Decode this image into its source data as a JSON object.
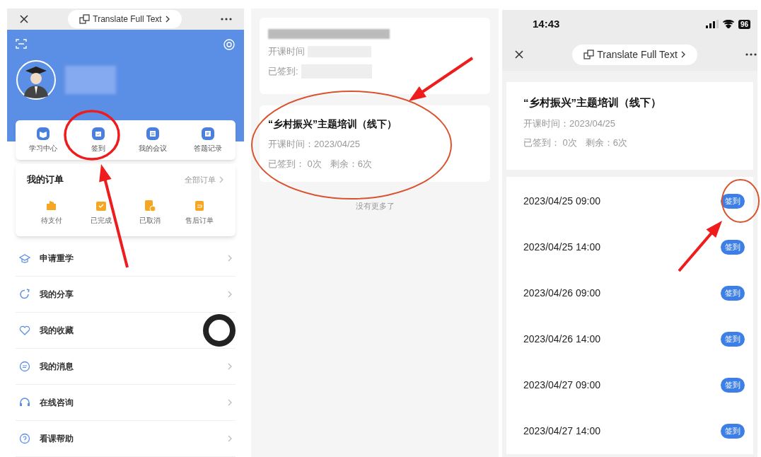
{
  "profile_screen": {
    "translate_label": "Translate Full Text",
    "quick_actions": [
      {
        "label": "学习中心"
      },
      {
        "label": "签到"
      },
      {
        "label": "我的会议"
      },
      {
        "label": "答题记录"
      }
    ],
    "orders": {
      "title": "我的订单",
      "all_link": "全部订单",
      "items": [
        {
          "label": "待支付"
        },
        {
          "label": "已完成"
        },
        {
          "label": "已取消"
        },
        {
          "label": "售后订单"
        }
      ]
    },
    "menu": [
      {
        "label": "申请重学",
        "floating_ball": false
      },
      {
        "label": "我的分享",
        "floating_ball": false
      },
      {
        "label": "我的收藏",
        "floating_ball": true
      },
      {
        "label": "我的消息",
        "floating_ball": false
      },
      {
        "label": "在线咨询",
        "floating_ball": false
      },
      {
        "label": "看课帮助",
        "floating_ball": false
      }
    ]
  },
  "course_list_screen": {
    "courses": [
      {
        "kind": "redacted",
        "start_label": "开课时间",
        "checkin_label": "已签到:"
      },
      {
        "kind": "full",
        "title": "“乡村振兴”主题培训（线下）",
        "start": "开课时间：2023/04/25",
        "checked": "已签到： 0次",
        "remaining": "剩余：6次"
      }
    ],
    "footer": "没有更多了"
  },
  "checkin_screen": {
    "time": "14:43",
    "battery": "96",
    "translate_label": "Translate Full Text",
    "course": {
      "title": "“乡村振兴”主题培训（线下）",
      "start": "开课时间：2023/04/25",
      "checked": "已签到： 0次",
      "remaining": "剩余：6次"
    },
    "sessions": [
      {
        "time": "2023/04/25 09:00",
        "button": "签到"
      },
      {
        "time": "2023/04/25 14:00",
        "button": "签到"
      },
      {
        "time": "2023/04/26 09:00",
        "button": "签到"
      },
      {
        "time": "2023/04/26 14:00",
        "button": "签到"
      },
      {
        "time": "2023/04/27 09:00",
        "button": "签到"
      },
      {
        "time": "2023/04/27 14:00",
        "button": "签到"
      }
    ]
  }
}
